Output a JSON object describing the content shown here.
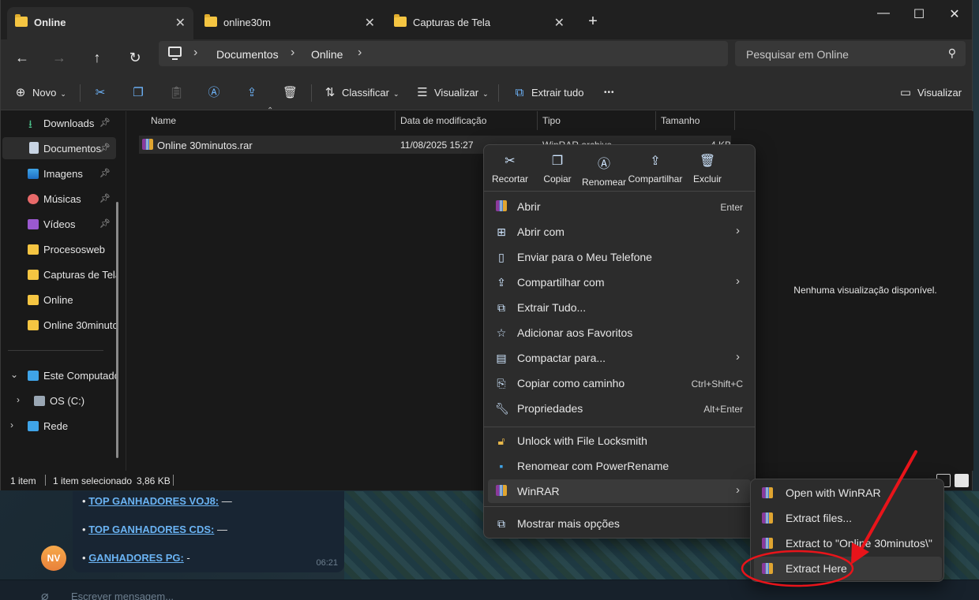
{
  "background_chat": {
    "messages": [
      {
        "bullet": "•",
        "link": "TOP GANHADORES VOJ8:",
        "rest": " —"
      },
      {
        "bullet": "•",
        "link": "TOP GANHADORES CDS:",
        "rest": " —"
      },
      {
        "bullet": "•",
        "link": "GANHADORES PG:",
        "rest": " -"
      }
    ],
    "time": "06:21",
    "avatar_initials": "NV",
    "composer_placeholder": "Escrever mensagem..."
  },
  "window": {
    "tabs": [
      {
        "label": "Online"
      },
      {
        "label": "online30m"
      },
      {
        "label": "Capturas de Tela"
      }
    ],
    "tab_close": "✕",
    "new_tab": "+",
    "controls": {
      "minimize": "—",
      "maximize": "☐",
      "close": "✕"
    }
  },
  "navigation": {
    "back": "←",
    "forward": "→",
    "up": "↑",
    "refresh": "↻",
    "breadcrumb": [
      "Documentos",
      "Online"
    ],
    "breadcrumb_sep": "›",
    "search_placeholder": "Pesquisar em Online"
  },
  "toolbar": {
    "new_label": "Novo",
    "sort_label": "Classificar",
    "view_label": "Visualizar",
    "extract_all_label": "Extrair tudo",
    "more_label": "•••",
    "details_pane_label": "Visualizar"
  },
  "sidebar": {
    "quick_access": [
      {
        "label": "Downloads",
        "pinned": true
      },
      {
        "label": "Documentos",
        "pinned": true
      },
      {
        "label": "Imagens",
        "pinned": true
      },
      {
        "label": "Músicas",
        "pinned": true
      },
      {
        "label": "Vídeos",
        "pinned": true
      },
      {
        "label": "Procesosweb",
        "pinned": false
      },
      {
        "label": "Capturas de Tela",
        "pinned": false
      },
      {
        "label": "Online",
        "pinned": false
      },
      {
        "label": "Online 30minutos",
        "pinned": false
      }
    ],
    "this_pc": "Este Computador",
    "drive": "OS (C:)",
    "network": "Rede"
  },
  "file_list": {
    "columns": [
      "Name",
      "Data de modificação",
      "Tipo",
      "Tamanho"
    ],
    "rows": [
      {
        "name": "Online 30minutos.rar",
        "modified": "11/08/2025 15:27",
        "type": "WinRAR archive",
        "size": "4 KB"
      }
    ]
  },
  "preview": {
    "text": "Nenhuma visualização disponível."
  },
  "status": {
    "count": "1 item",
    "selected": "1 item selecionado",
    "size": "3,86 KB"
  },
  "context_menu": {
    "quick_actions": [
      "Recortar",
      "Copiar",
      "Renomear",
      "Compartilhar",
      "Excluir"
    ],
    "items": [
      {
        "label": "Abrir",
        "shortcut": "Enter",
        "submenu": false,
        "icon": "winrar-icon"
      },
      {
        "label": "Abrir com",
        "shortcut": "",
        "submenu": true,
        "icon": "open-with-icon"
      },
      {
        "label": "Enviar para o Meu Telefone",
        "shortcut": "",
        "submenu": false,
        "icon": "phone-icon"
      },
      {
        "label": "Compartilhar com",
        "shortcut": "",
        "submenu": true,
        "icon": "share-icon"
      },
      {
        "label": "Extrair Tudo...",
        "shortcut": "",
        "submenu": false,
        "icon": "extract-icon"
      },
      {
        "label": "Adicionar aos Favoritos",
        "shortcut": "",
        "submenu": false,
        "icon": "star-icon"
      },
      {
        "label": "Compactar para...",
        "shortcut": "",
        "submenu": true,
        "icon": "compress-icon"
      },
      {
        "label": "Copiar como caminho",
        "shortcut": "Ctrl+Shift+C",
        "submenu": false,
        "icon": "path-icon"
      },
      {
        "label": "Propriedades",
        "shortcut": "Alt+Enter",
        "submenu": false,
        "icon": "wrench-icon"
      }
    ],
    "extra_items": [
      {
        "label": "Unlock with File Locksmith",
        "icon": "lock-icon"
      },
      {
        "label": "Renomear com PowerRename",
        "icon": "rename-icon"
      }
    ],
    "winrar_label": "WinRAR",
    "more_options_label": "Mostrar mais opções"
  },
  "winrar_submenu": {
    "items": [
      "Open with WinRAR",
      "Extract files...",
      "Extract to \"Online 30minutos\\\"",
      "Extract Here"
    ]
  },
  "annotation": {
    "color": "#e8141a",
    "target": "Extract Here"
  }
}
